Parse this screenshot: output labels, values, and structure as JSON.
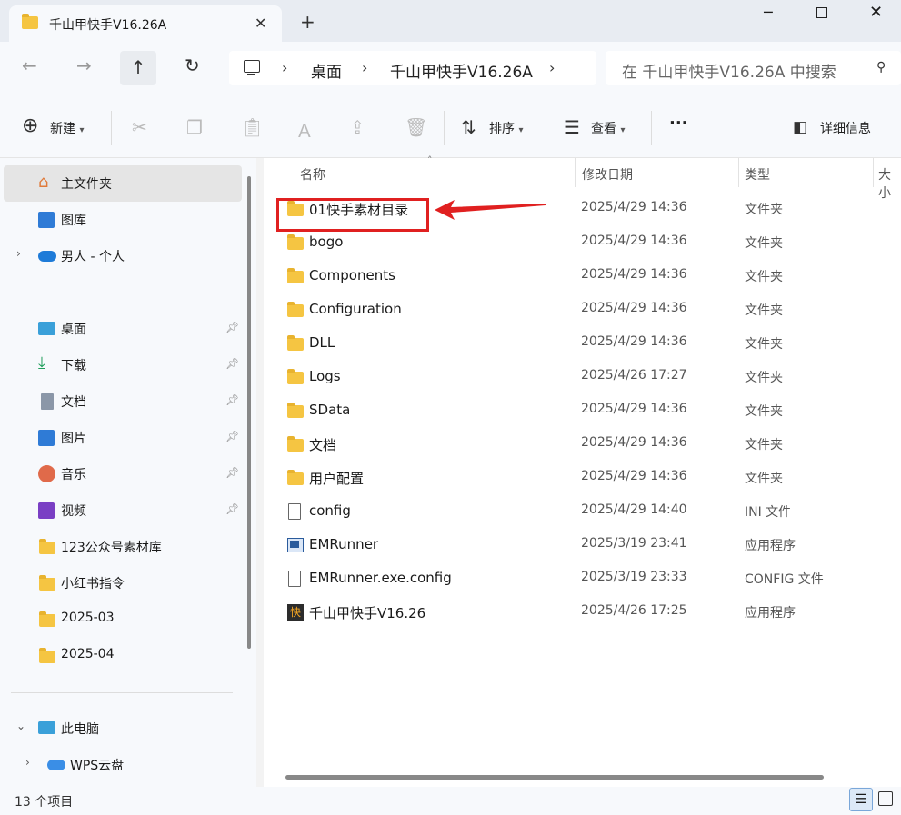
{
  "window": {
    "tab_title": "千山甲快手V16.26A",
    "tab_close": "✕",
    "new_tab": "+",
    "minimize": "─",
    "close": "✕"
  },
  "navigation": {
    "back": "←",
    "forward": "→",
    "up": "↑",
    "refresh": "↻",
    "breadcrumb": [
      "桌面",
      "千山甲快手V16.26A"
    ],
    "search_placeholder": "在 千山甲快手V16.26A 中搜索"
  },
  "toolbar": {
    "new_label": "新建",
    "sort_label": "排序",
    "view_label": "查看",
    "more": "···",
    "details_label": "详细信息"
  },
  "sidebar": {
    "top_items": [
      {
        "label": "主文件夹",
        "icon": "home-icon",
        "selected": true
      },
      {
        "label": "图库",
        "icon": "gallery-icon"
      },
      {
        "label": "男人 - 个人",
        "icon": "onedrive-cloud-icon",
        "expandable": true
      }
    ],
    "quick_access": [
      {
        "label": "桌面",
        "icon": "desktop-icon",
        "pinned": true
      },
      {
        "label": "下载",
        "icon": "download-icon",
        "pinned": true
      },
      {
        "label": "文档",
        "icon": "document-icon",
        "pinned": true
      },
      {
        "label": "图片",
        "icon": "pictures-icon",
        "pinned": true
      },
      {
        "label": "音乐",
        "icon": "music-icon",
        "pinned": true
      },
      {
        "label": "视频",
        "icon": "video-icon",
        "pinned": true
      },
      {
        "label": "123公众号素材库",
        "icon": "folder-icon"
      },
      {
        "label": "小红书指令",
        "icon": "folder-icon"
      },
      {
        "label": "2025-03",
        "icon": "folder-icon"
      },
      {
        "label": "2025-04",
        "icon": "folder-icon"
      }
    ],
    "this_pc": "此电脑",
    "wps": "WPS云盘"
  },
  "columns": {
    "name": "名称",
    "date": "修改日期",
    "type": "类型",
    "size": "大小"
  },
  "files": [
    {
      "name": "01快手素材目录",
      "date": "2025/4/29 14:36",
      "type": "文件夹",
      "icon": "folder-icon"
    },
    {
      "name": "bogo",
      "date": "2025/4/29 14:36",
      "type": "文件夹",
      "icon": "folder-icon"
    },
    {
      "name": "Components",
      "date": "2025/4/29 14:36",
      "type": "文件夹",
      "icon": "folder-icon"
    },
    {
      "name": "Configuration",
      "date": "2025/4/29 14:36",
      "type": "文件夹",
      "icon": "folder-icon"
    },
    {
      "name": "DLL",
      "date": "2025/4/29 14:36",
      "type": "文件夹",
      "icon": "folder-icon"
    },
    {
      "name": "Logs",
      "date": "2025/4/26 17:27",
      "type": "文件夹",
      "icon": "folder-icon"
    },
    {
      "name": "SData",
      "date": "2025/4/29 14:36",
      "type": "文件夹",
      "icon": "folder-icon"
    },
    {
      "name": "文档",
      "date": "2025/4/29 14:36",
      "type": "文件夹",
      "icon": "folder-icon"
    },
    {
      "name": "用户配置",
      "date": "2025/4/29 14:36",
      "type": "文件夹",
      "icon": "folder-icon"
    },
    {
      "name": "config",
      "date": "2025/4/29 14:40",
      "type": "INI 文件",
      "icon": "file-icon"
    },
    {
      "name": "EMRunner",
      "date": "2025/3/19 23:41",
      "type": "应用程序",
      "icon": "app-icon"
    },
    {
      "name": "EMRunner.exe.config",
      "date": "2025/3/19 23:33",
      "type": "CONFIG 文件",
      "icon": "file-icon"
    },
    {
      "name": "千山甲快手V16.26",
      "date": "2025/4/26 17:25",
      "type": "应用程序",
      "icon": "kuaishou-app-icon",
      "icon_glyph": "快"
    }
  ],
  "status": {
    "item_count": "13 个项目"
  },
  "colors": {
    "highlight": "#e02020",
    "folder": "#f5c542",
    "selected_bg": "#e5e5e5"
  }
}
